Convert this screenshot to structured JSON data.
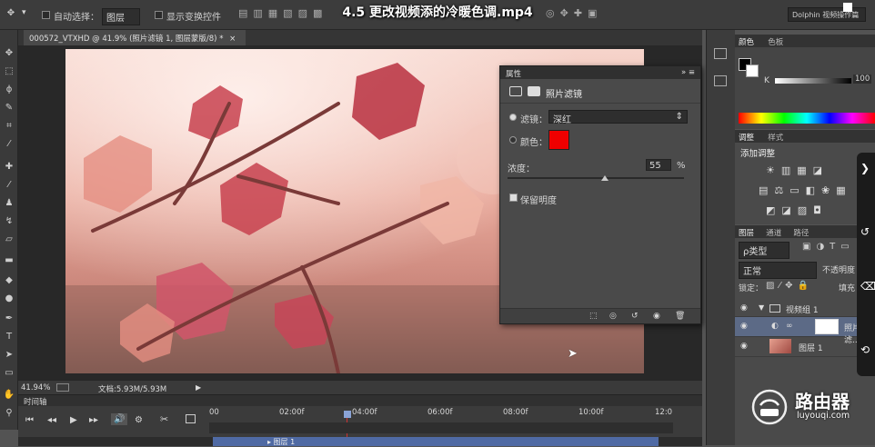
{
  "video_title": "4.5 更改视频添的冷暖色调.mp4",
  "options_bar": {
    "auto_select_label": "自动选择：",
    "auto_select_value": "图层",
    "show_transform_label": "显示变换控件",
    "workspace_label": "Dolphin 视频操作篇"
  },
  "document_tab": {
    "title": "000572_VTXHD @ 41.9% (照片滤镜 1, 图层蒙版/8) *",
    "close": "×"
  },
  "statusbar": {
    "zoom": "41.94%",
    "doc_size": "文档:5.93M/5.93M"
  },
  "properties_panel": {
    "tab_label": "属性",
    "header_label": "照片滤镜",
    "filter_label": "滤镜：",
    "filter_value": "深红",
    "color_label": "颜色：",
    "color_swatch": "#ef0000",
    "density_label": "浓度：",
    "density_value": "55",
    "density_unit": "%",
    "density_fraction": 0.55,
    "preserve_label": "保留明度"
  },
  "timeline": {
    "tab_label": "时间轴",
    "ticks": [
      "00",
      "02:00f",
      "04:00f",
      "06:00f",
      "08:00f",
      "10:00f",
      "12:0"
    ],
    "track_label": "▸ 图层 1"
  },
  "color_panel": {
    "tabs": [
      "颜色",
      "色板"
    ],
    "channel_label": "K",
    "channel_value": "100",
    "channel_unit": "%"
  },
  "adjustments_panel": {
    "tabs": [
      "调整",
      "样式"
    ],
    "title": "添加调整"
  },
  "layers_panel": {
    "tabs": [
      "图层",
      "通道",
      "路径"
    ],
    "filter_kind": "ρ类型",
    "blend_mode": "正常",
    "opacity_label": "不透明度",
    "lock_label": "锁定：",
    "fill_label": "填充",
    "layers": [
      {
        "name": "视频组 1",
        "kind": "group"
      },
      {
        "name": "照片滤...",
        "kind": "adjustment"
      },
      {
        "name": "图层 1",
        "kind": "video"
      }
    ]
  },
  "watermark": {
    "brand": "路由器",
    "url": "luyouqi.com"
  },
  "colors": {
    "accent": "#ef0000",
    "panel_bg": "#4a4a4a",
    "selected_row": "#5c6a86"
  }
}
